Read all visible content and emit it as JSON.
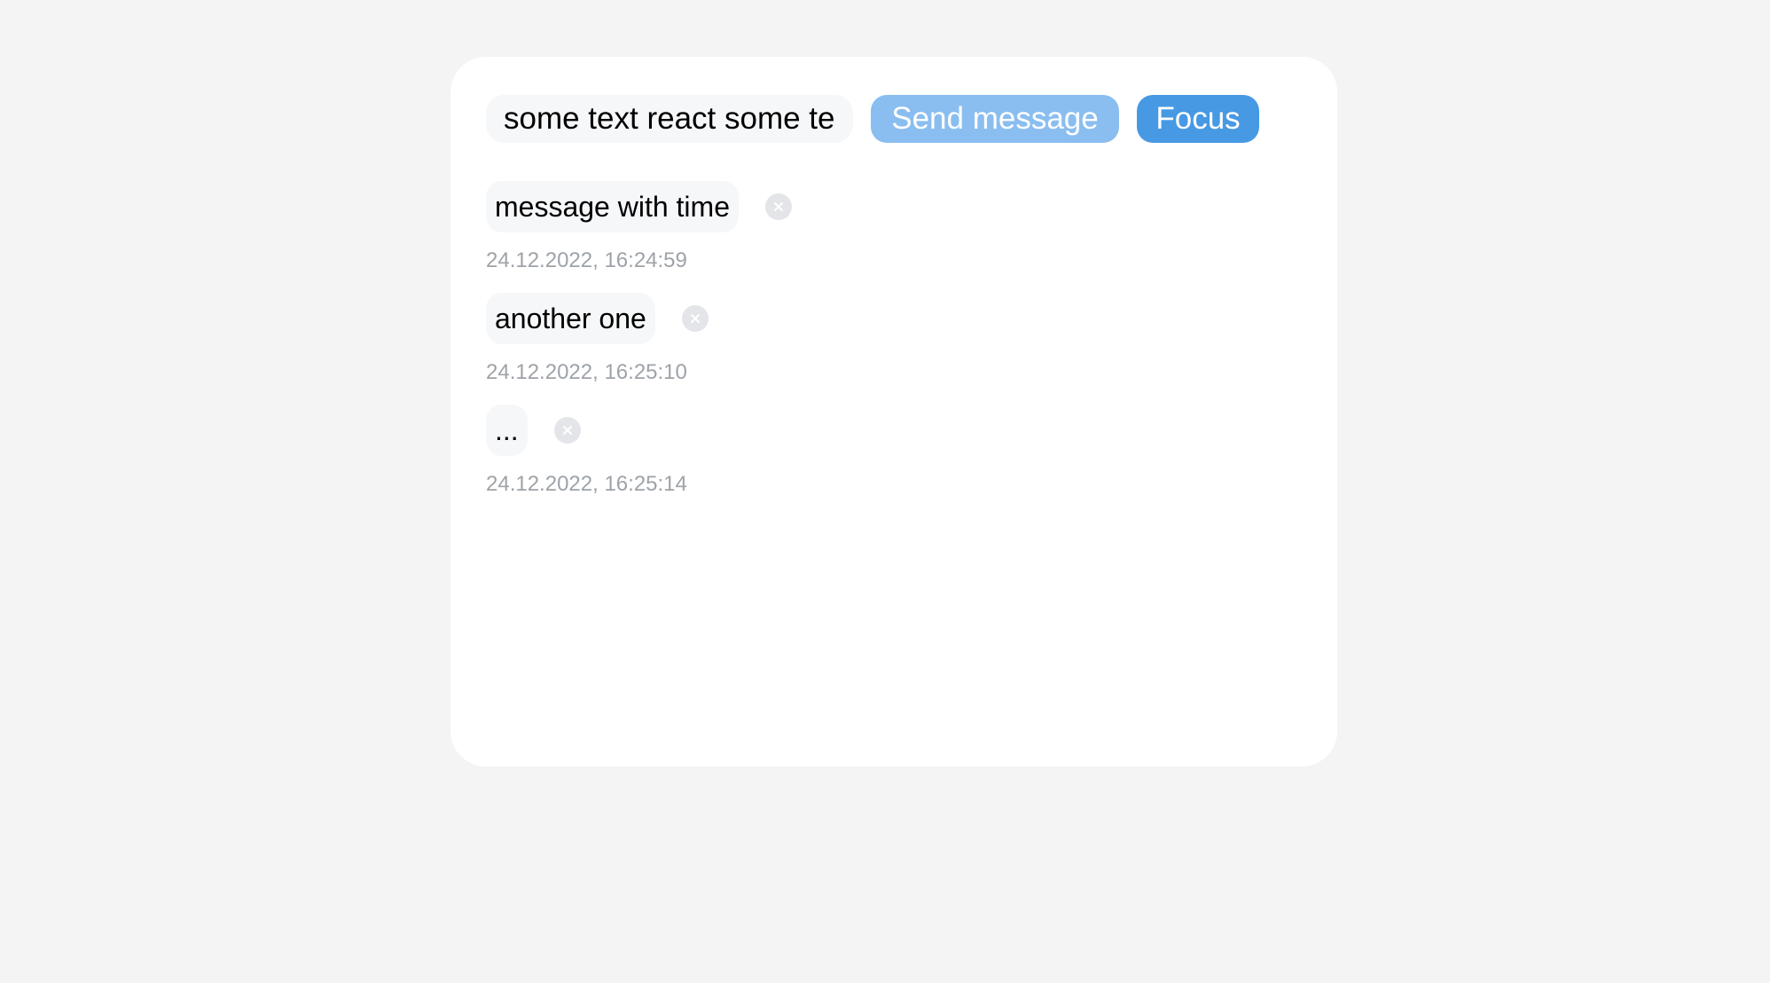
{
  "composer": {
    "input_value": "some text react some text",
    "send_label": "Send message",
    "focus_label": "Focus"
  },
  "messages": [
    {
      "text": "message with time",
      "time": "24.12.2022, 16:24:59"
    },
    {
      "text": "another one",
      "time": "24.12.2022, 16:25:10"
    },
    {
      "text": "...",
      "time": "24.12.2022, 16:25:14"
    }
  ],
  "icons": {
    "delete": "close-circle-icon"
  },
  "colors": {
    "background": "#f4f4f4",
    "card": "#ffffff",
    "send_button": "#8abef0",
    "focus_button": "#4799e3",
    "bubble": "#f6f7f9",
    "timestamp": "#9ea3a8"
  }
}
